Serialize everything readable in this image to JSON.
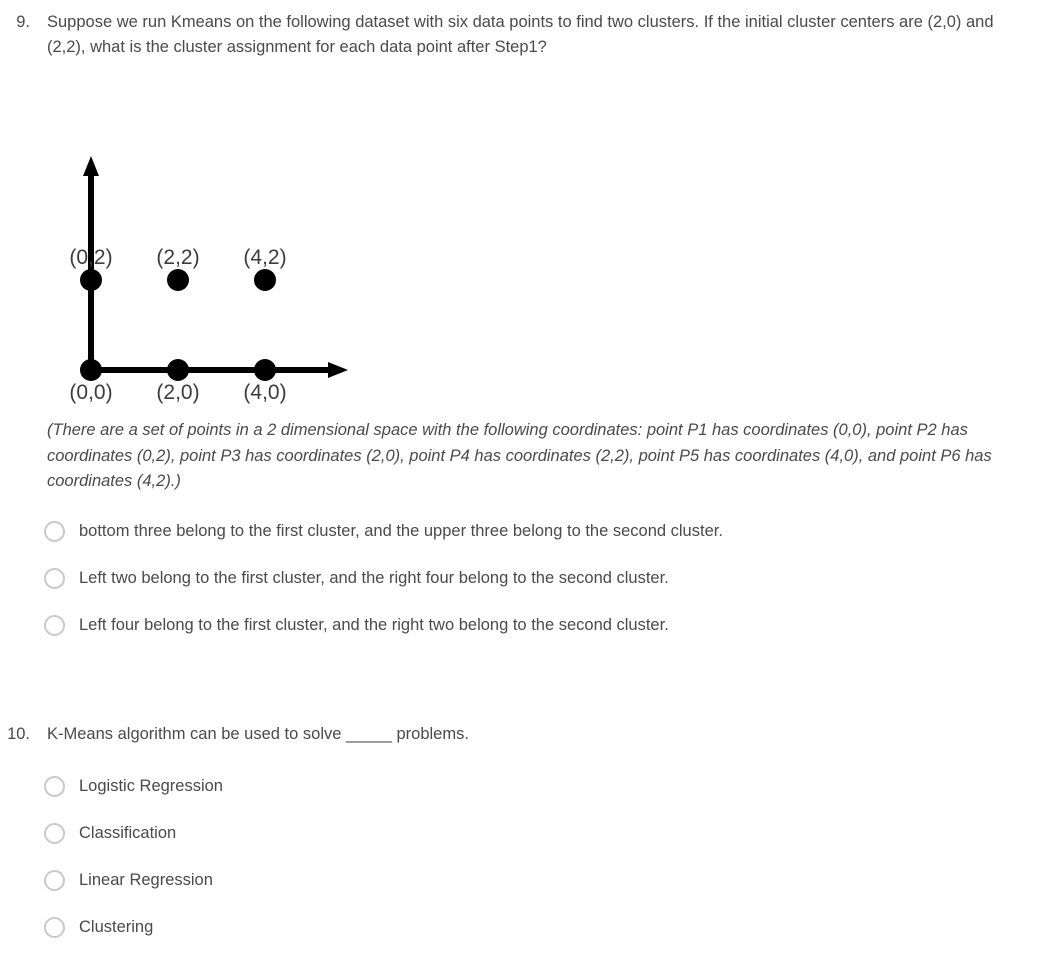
{
  "questions": [
    {
      "number": "9.",
      "text": "Suppose we run Kmeans on the following dataset with six data points to find two clusters. If the initial cluster centers are (2,0) and (2,2), what is the cluster assignment for each data point after Step1?",
      "caption": "(There are a set of points in a 2 dimensional space with the following coordinates: point P1 has coordinates (0,0), point P2 has coordinates (0,2), point P3 has coordinates (2,0), point P4 has coordinates (2,2), point P5 has coordinates (4,0), and point P6 has coordinates (4,2).)",
      "options": [
        "bottom three belong to the first cluster, and the upper three belong to the second cluster.",
        "Left two belong to the first cluster, and the right four belong to the second cluster.",
        "Left four belong to the first cluster, and the right two belong to the second cluster."
      ]
    },
    {
      "number": "10.",
      "text_before_blank": "K-Means algorithm can be used to solve ",
      "blank": "_____",
      "text_after_blank": " problems.",
      "options": [
        "Logistic Regression",
        "Classification",
        "Linear Regression",
        "Clustering"
      ]
    }
  ],
  "chart_data": {
    "type": "scatter",
    "title": "",
    "xlabel": "",
    "ylabel": "",
    "xlim": [
      0,
      6
    ],
    "ylim": [
      0,
      5
    ],
    "grid": false,
    "legend": "none",
    "point_color": "#000000",
    "axis_color": "#000000",
    "label_color": "#3c3c3c",
    "points": [
      {
        "name": "P1",
        "x": 0,
        "y": 0,
        "label": "(0,0)",
        "label_position": "below"
      },
      {
        "name": "P3",
        "x": 2,
        "y": 0,
        "label": "(2,0)",
        "label_position": "below"
      },
      {
        "name": "P5",
        "x": 4,
        "y": 0,
        "label": "(4,0)",
        "label_position": "below"
      },
      {
        "name": "P2",
        "x": 0,
        "y": 2,
        "label": "(0,2)",
        "label_position": "above"
      },
      {
        "name": "P4",
        "x": 2,
        "y": 2,
        "label": "(2,2)",
        "label_position": "above"
      },
      {
        "name": "P6",
        "x": 4,
        "y": 2,
        "label": "(4,2)",
        "label_position": "above"
      }
    ]
  }
}
